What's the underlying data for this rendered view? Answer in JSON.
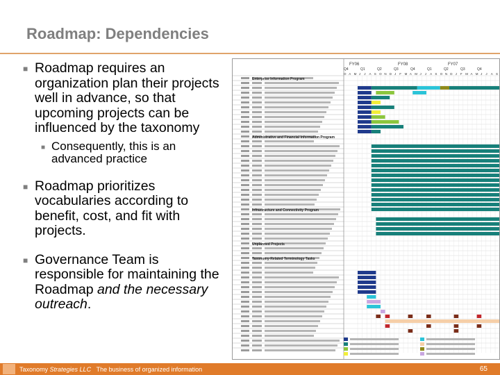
{
  "slide": {
    "title": "Roadmap: Dependencies",
    "bullets": [
      {
        "text": "Roadmap requires an organization plan their projects well in advance, so that upcoming projects can be influenced by the taxonomy"
      },
      {
        "text": "Consequently, this is an advanced practice"
      },
      {
        "text": "Roadmap prioritizes vocabularies according to benefit, cost, and fit with projects."
      },
      {
        "text_plain": "Governance Team is responsible for maintaining the Roadmap ",
        "text_em": "and the necessary outreach",
        "text_end": "."
      }
    ]
  },
  "footer": {
    "company": "Taxonomy ",
    "company_em": "Strategies LLC",
    "tagline": "The business of organized information",
    "page_number": "65"
  },
  "gantt": {
    "fiscal_years": [
      "FY06",
      "FY08",
      "FY07"
    ],
    "quarters": [
      "Q4",
      "Q1",
      "Q2",
      "Q3",
      "Q4",
      "Q1",
      "Q2",
      "Q3",
      "Q4"
    ],
    "months": [
      "O",
      "A",
      "M",
      "J",
      "J",
      "A",
      "S",
      "O",
      "N",
      "D",
      "J",
      "F",
      "M",
      "A",
      "M",
      "J",
      "J",
      "A",
      "S",
      "O",
      "N",
      "D",
      "J",
      "F",
      "M",
      "A",
      "M",
      "J",
      "J",
      "A",
      "S"
    ],
    "sections": [
      "Enterprise Information Program",
      "Administrative and Financial Information Program",
      "Infrastructure and Connectivity Program",
      "Unplanned Projects",
      "Taxonomy-Related Terminology Tasks"
    ],
    "colors": {
      "navy": "#1f3a8c",
      "teal": "#17807a",
      "green": "#8cc63e",
      "cyan": "#2bc4d8",
      "yellow": "#f2ee3a",
      "olive": "#8f8a1a",
      "brown": "#7b2e1a",
      "peach": "#f6cfa8",
      "lavender": "#c9a6e0",
      "red": "#c2272d"
    }
  }
}
